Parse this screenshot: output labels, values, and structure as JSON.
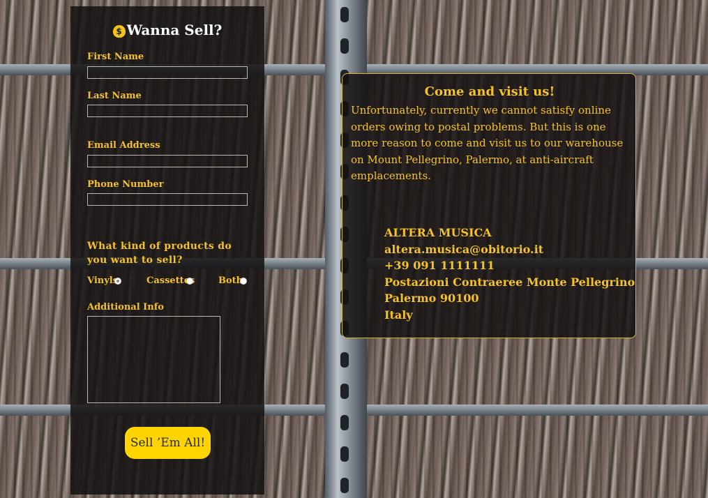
{
  "form": {
    "title": "Wanna Sell?",
    "bag_glyph": "$",
    "first_name_label": "First Name",
    "last_name_label": "Last Name",
    "email_label": "Email Address",
    "phone_label": "Phone Number",
    "question": "What kind of products do you want to sell?",
    "options": [
      {
        "label": "Vinyls",
        "checked": true
      },
      {
        "label": "Cassettes",
        "checked": false
      },
      {
        "label": "Both",
        "checked": false
      }
    ],
    "additional_label": "Additional Info",
    "submit_label": "Sell ’Em All!"
  },
  "info": {
    "title": "Come and visit us!",
    "body": "Unfortunately, currently we cannot satisfy online orders owing to postal problems. But this is one more reason to come and visit us to our warehouse on Mount Pellegrino, Palermo, at anti-aircraft emplacements.",
    "contact": {
      "name": "ALTERA MUSICA",
      "email": "altera.musica@obitorio.it",
      "phone": "+39 091 1111111",
      "address": "Postazioni Contraeree Monte Pellegrino",
      "city": "Palermo 90100",
      "country": "Italy"
    }
  },
  "colors": {
    "accent": "#f4c22a",
    "button": "#ffd400",
    "panel": "#141111"
  },
  "icons": [
    "money-bag-icon"
  ]
}
